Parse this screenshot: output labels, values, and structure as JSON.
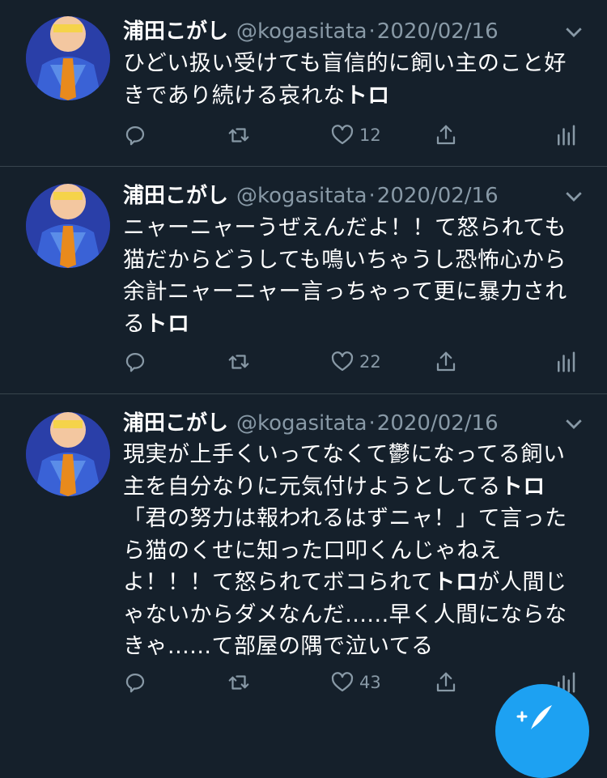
{
  "tweets": [
    {
      "name": "浦田こがし",
      "handle": "@kogasitata",
      "separator": "·",
      "date": "2020/02/16",
      "text_parts": [
        "ひどい扱い受けても盲信的に飼い主のこと好\nきであり続ける哀れな",
        "トロ",
        ""
      ],
      "like_count": "12"
    },
    {
      "name": "浦田こがし",
      "handle": "@kogasitata",
      "separator": "·",
      "date": "2020/02/16",
      "text_parts": [
        "ニャーニャーうぜえんだよ！！て怒られても\n猫だからどうしても鳴いちゃうし恐怖心から\n余計ニャーニャー言っちゃって更に暴力され\nる",
        "トロ",
        ""
      ],
      "like_count": "22"
    },
    {
      "name": "浦田こがし",
      "handle": "@kogasitata",
      "separator": "·",
      "date": "2020/02/16",
      "text_parts": [
        "現実が上手くいってなくて鬱になってる飼い\n主を自分なりに元気付けようとしてる",
        "トロ",
        "\n「君の努力は報われるはずニャ！」て言った\nら猫のくせに知った口叩くんじゃねえ\nよ！！！て怒られてボコられて",
        "トロ",
        "が人間じ\nゃないからダメなんだ......早く人間にならな\nきゃ......て部屋の隅で泣いてる"
      ],
      "like_count": "43"
    }
  ],
  "colors": {
    "background": "#15202b",
    "text": "#ffffff",
    "secondary": "#8899a6",
    "divider": "#38444d",
    "accent": "#1da1f2"
  },
  "icons": [
    "reply-icon",
    "retweet-icon",
    "like-icon",
    "share-icon",
    "analytics-icon",
    "chevron-down-icon",
    "compose-tweet-icon"
  ]
}
